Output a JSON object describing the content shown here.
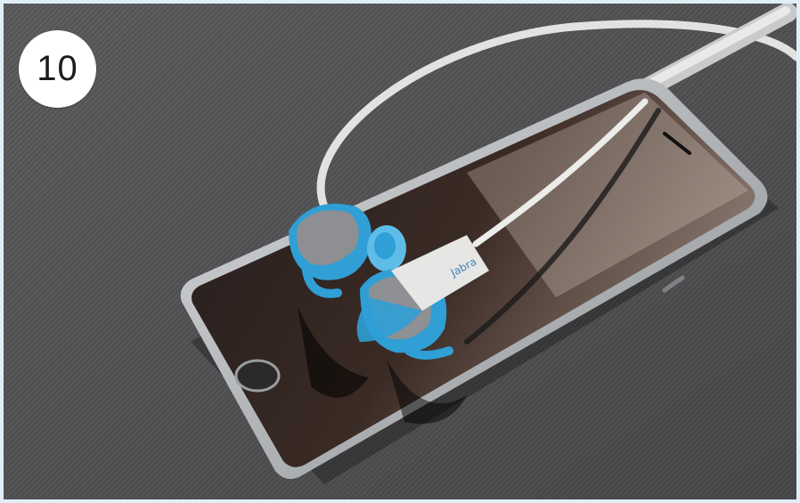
{
  "badge": {
    "number": "10"
  },
  "product": {
    "brand_text": "Jabra"
  },
  "colors": {
    "frame": "#dfeef7",
    "fabric": "#5a5a5c",
    "phone_body": "#b9bcc0",
    "screen": "#1f1a1a",
    "earbud_accent": "#2f9fd6",
    "cable": "#e8e8e6"
  }
}
